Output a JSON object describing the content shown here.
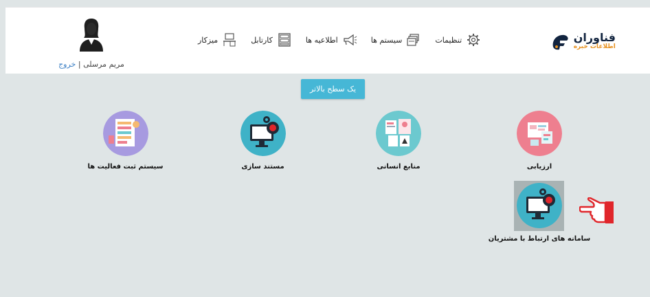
{
  "header": {
    "logo": {
      "main": "فناوران",
      "sub": "اطلاعات خبره",
      "color_main": "#12243f",
      "color_sub": "#e79221"
    },
    "nav": [
      {
        "label": "تنظیمات",
        "icon": "gear-icon"
      },
      {
        "label": "سیستم ها",
        "icon": "folders-icon"
      },
      {
        "label": "اطلاعیه ها",
        "icon": "megaphone-icon"
      },
      {
        "label": "کارتابل",
        "icon": "cabinet-icon"
      },
      {
        "label": "میزکار",
        "icon": "desk-icon"
      }
    ],
    "user": {
      "name": "مریم مرسلی",
      "separator": "|",
      "logout": "خروج"
    }
  },
  "main": {
    "up_button": "یک سطح بالاتر",
    "tiles": [
      {
        "label": "ارزیابی",
        "color": "#ee7f8f"
      },
      {
        "label": "منابع انسانی",
        "color": "#6cc9cf"
      },
      {
        "label": "مستند سازی",
        "color": "#3fb2c7"
      },
      {
        "label": "سیستم ثبت فعالیت ها",
        "color": "#a79ae0"
      },
      {
        "label": "سامانه های ارتباط با مشتریان",
        "color": "#3fb2c7"
      }
    ],
    "accent_button_color": "#46b7d6",
    "pointer_color": "#e0262b"
  }
}
